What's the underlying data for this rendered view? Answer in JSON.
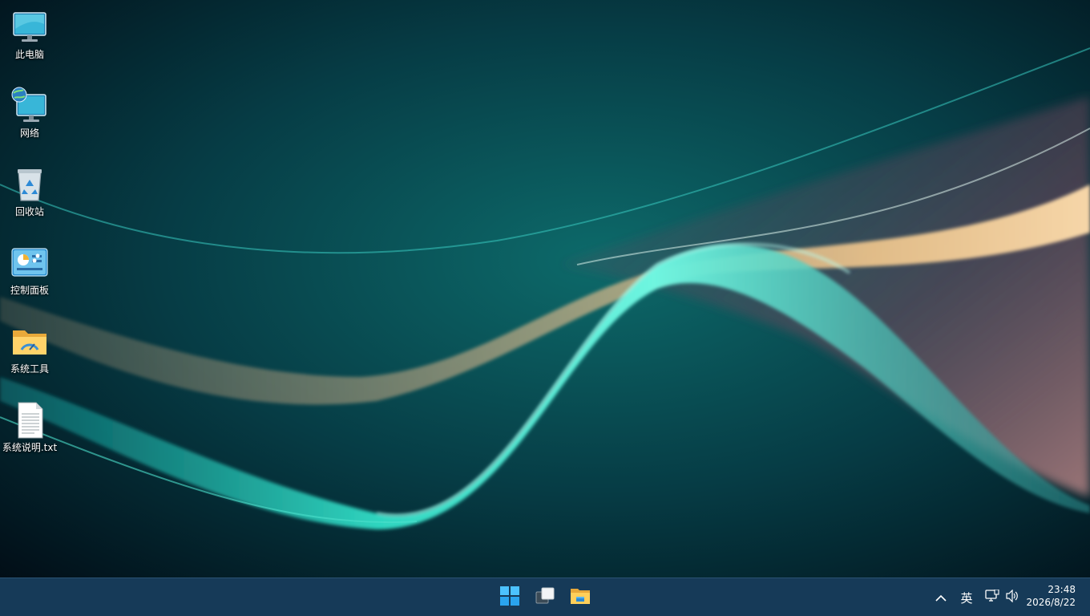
{
  "desktop": {
    "icons": [
      {
        "label": "此电脑",
        "icon": "computer-icon"
      },
      {
        "label": "网络",
        "icon": "network-icon"
      },
      {
        "label": "回收站",
        "icon": "recycle-bin-icon"
      },
      {
        "label": "控制面板",
        "icon": "control-panel-icon"
      },
      {
        "label": "系统工具",
        "icon": "folder-icon"
      },
      {
        "label": "系统说明.txt",
        "icon": "text-file-icon"
      }
    ]
  },
  "taskbar": {
    "pinned": [
      {
        "icon": "windows-start-icon"
      },
      {
        "icon": "task-view-icon"
      },
      {
        "icon": "file-explorer-icon"
      }
    ],
    "tray": {
      "chevron_icon": "chevron-up-icon",
      "ime_label": "英",
      "network_icon": "network-status-icon",
      "volume_icon": "volume-icon"
    },
    "clock": {
      "time": "23:48",
      "date": "2026/8/22"
    }
  },
  "colors": {
    "taskbar_bg": "#163a58",
    "wallpaper_teal": "#3fe0c8",
    "wallpaper_dark": "#02161f"
  }
}
